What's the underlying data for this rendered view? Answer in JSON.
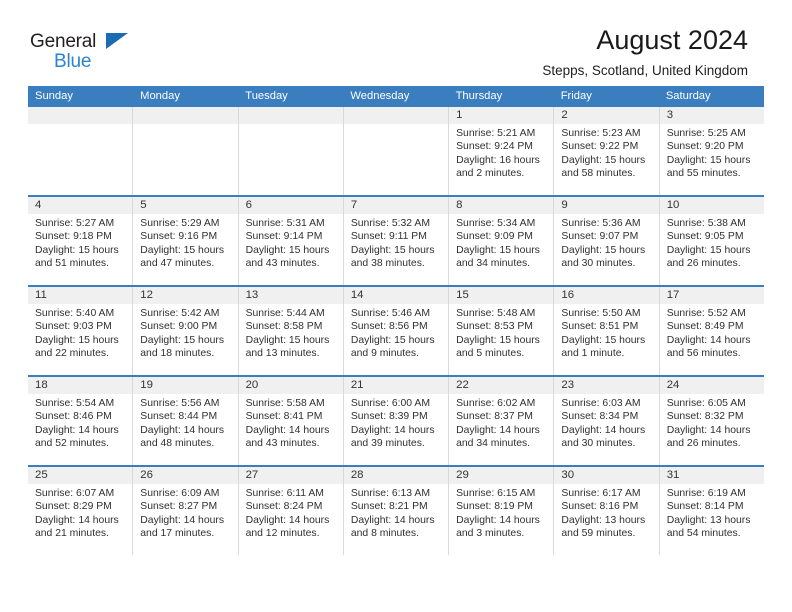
{
  "brand": {
    "line1": "General",
    "line2": "Blue",
    "accent": "#2b84cf",
    "triangle": "#1c6cb5"
  },
  "header": {
    "title": "August 2024",
    "subtitle": "Stepps, Scotland, United Kingdom"
  },
  "theme": {
    "header_bar": "#3a7ebf",
    "daynum_band": "#f0f0f0",
    "cell_border": "#d9d9d9",
    "text": "#303030"
  },
  "labels": {
    "sunrise": "Sunrise:",
    "sunset": "Sunset:",
    "daylight": "Daylight:"
  },
  "weekdays": [
    "Sunday",
    "Monday",
    "Tuesday",
    "Wednesday",
    "Thursday",
    "Friday",
    "Saturday"
  ],
  "weeks": [
    [
      {
        "day": "",
        "empty": true
      },
      {
        "day": "",
        "empty": true
      },
      {
        "day": "",
        "empty": true
      },
      {
        "day": "",
        "empty": true
      },
      {
        "day": "1",
        "sunrise": "Sunrise: 5:21 AM",
        "sunset": "Sunset: 9:24 PM",
        "daylight1": "Daylight: 16 hours",
        "daylight2": "and 2 minutes."
      },
      {
        "day": "2",
        "sunrise": "Sunrise: 5:23 AM",
        "sunset": "Sunset: 9:22 PM",
        "daylight1": "Daylight: 15 hours",
        "daylight2": "and 58 minutes."
      },
      {
        "day": "3",
        "sunrise": "Sunrise: 5:25 AM",
        "sunset": "Sunset: 9:20 PM",
        "daylight1": "Daylight: 15 hours",
        "daylight2": "and 55 minutes."
      }
    ],
    [
      {
        "day": "4",
        "sunrise": "Sunrise: 5:27 AM",
        "sunset": "Sunset: 9:18 PM",
        "daylight1": "Daylight: 15 hours",
        "daylight2": "and 51 minutes."
      },
      {
        "day": "5",
        "sunrise": "Sunrise: 5:29 AM",
        "sunset": "Sunset: 9:16 PM",
        "daylight1": "Daylight: 15 hours",
        "daylight2": "and 47 minutes."
      },
      {
        "day": "6",
        "sunrise": "Sunrise: 5:31 AM",
        "sunset": "Sunset: 9:14 PM",
        "daylight1": "Daylight: 15 hours",
        "daylight2": "and 43 minutes."
      },
      {
        "day": "7",
        "sunrise": "Sunrise: 5:32 AM",
        "sunset": "Sunset: 9:11 PM",
        "daylight1": "Daylight: 15 hours",
        "daylight2": "and 38 minutes."
      },
      {
        "day": "8",
        "sunrise": "Sunrise: 5:34 AM",
        "sunset": "Sunset: 9:09 PM",
        "daylight1": "Daylight: 15 hours",
        "daylight2": "and 34 minutes."
      },
      {
        "day": "9",
        "sunrise": "Sunrise: 5:36 AM",
        "sunset": "Sunset: 9:07 PM",
        "daylight1": "Daylight: 15 hours",
        "daylight2": "and 30 minutes."
      },
      {
        "day": "10",
        "sunrise": "Sunrise: 5:38 AM",
        "sunset": "Sunset: 9:05 PM",
        "daylight1": "Daylight: 15 hours",
        "daylight2": "and 26 minutes."
      }
    ],
    [
      {
        "day": "11",
        "sunrise": "Sunrise: 5:40 AM",
        "sunset": "Sunset: 9:03 PM",
        "daylight1": "Daylight: 15 hours",
        "daylight2": "and 22 minutes."
      },
      {
        "day": "12",
        "sunrise": "Sunrise: 5:42 AM",
        "sunset": "Sunset: 9:00 PM",
        "daylight1": "Daylight: 15 hours",
        "daylight2": "and 18 minutes."
      },
      {
        "day": "13",
        "sunrise": "Sunrise: 5:44 AM",
        "sunset": "Sunset: 8:58 PM",
        "daylight1": "Daylight: 15 hours",
        "daylight2": "and 13 minutes."
      },
      {
        "day": "14",
        "sunrise": "Sunrise: 5:46 AM",
        "sunset": "Sunset: 8:56 PM",
        "daylight1": "Daylight: 15 hours",
        "daylight2": "and 9 minutes."
      },
      {
        "day": "15",
        "sunrise": "Sunrise: 5:48 AM",
        "sunset": "Sunset: 8:53 PM",
        "daylight1": "Daylight: 15 hours",
        "daylight2": "and 5 minutes."
      },
      {
        "day": "16",
        "sunrise": "Sunrise: 5:50 AM",
        "sunset": "Sunset: 8:51 PM",
        "daylight1": "Daylight: 15 hours",
        "daylight2": "and 1 minute."
      },
      {
        "day": "17",
        "sunrise": "Sunrise: 5:52 AM",
        "sunset": "Sunset: 8:49 PM",
        "daylight1": "Daylight: 14 hours",
        "daylight2": "and 56 minutes."
      }
    ],
    [
      {
        "day": "18",
        "sunrise": "Sunrise: 5:54 AM",
        "sunset": "Sunset: 8:46 PM",
        "daylight1": "Daylight: 14 hours",
        "daylight2": "and 52 minutes."
      },
      {
        "day": "19",
        "sunrise": "Sunrise: 5:56 AM",
        "sunset": "Sunset: 8:44 PM",
        "daylight1": "Daylight: 14 hours",
        "daylight2": "and 48 minutes."
      },
      {
        "day": "20",
        "sunrise": "Sunrise: 5:58 AM",
        "sunset": "Sunset: 8:41 PM",
        "daylight1": "Daylight: 14 hours",
        "daylight2": "and 43 minutes."
      },
      {
        "day": "21",
        "sunrise": "Sunrise: 6:00 AM",
        "sunset": "Sunset: 8:39 PM",
        "daylight1": "Daylight: 14 hours",
        "daylight2": "and 39 minutes."
      },
      {
        "day": "22",
        "sunrise": "Sunrise: 6:02 AM",
        "sunset": "Sunset: 8:37 PM",
        "daylight1": "Daylight: 14 hours",
        "daylight2": "and 34 minutes."
      },
      {
        "day": "23",
        "sunrise": "Sunrise: 6:03 AM",
        "sunset": "Sunset: 8:34 PM",
        "daylight1": "Daylight: 14 hours",
        "daylight2": "and 30 minutes."
      },
      {
        "day": "24",
        "sunrise": "Sunrise: 6:05 AM",
        "sunset": "Sunset: 8:32 PM",
        "daylight1": "Daylight: 14 hours",
        "daylight2": "and 26 minutes."
      }
    ],
    [
      {
        "day": "25",
        "sunrise": "Sunrise: 6:07 AM",
        "sunset": "Sunset: 8:29 PM",
        "daylight1": "Daylight: 14 hours",
        "daylight2": "and 21 minutes."
      },
      {
        "day": "26",
        "sunrise": "Sunrise: 6:09 AM",
        "sunset": "Sunset: 8:27 PM",
        "daylight1": "Daylight: 14 hours",
        "daylight2": "and 17 minutes."
      },
      {
        "day": "27",
        "sunrise": "Sunrise: 6:11 AM",
        "sunset": "Sunset: 8:24 PM",
        "daylight1": "Daylight: 14 hours",
        "daylight2": "and 12 minutes."
      },
      {
        "day": "28",
        "sunrise": "Sunrise: 6:13 AM",
        "sunset": "Sunset: 8:21 PM",
        "daylight1": "Daylight: 14 hours",
        "daylight2": "and 8 minutes."
      },
      {
        "day": "29",
        "sunrise": "Sunrise: 6:15 AM",
        "sunset": "Sunset: 8:19 PM",
        "daylight1": "Daylight: 14 hours",
        "daylight2": "and 3 minutes."
      },
      {
        "day": "30",
        "sunrise": "Sunrise: 6:17 AM",
        "sunset": "Sunset: 8:16 PM",
        "daylight1": "Daylight: 13 hours",
        "daylight2": "and 59 minutes."
      },
      {
        "day": "31",
        "sunrise": "Sunrise: 6:19 AM",
        "sunset": "Sunset: 8:14 PM",
        "daylight1": "Daylight: 13 hours",
        "daylight2": "and 54 minutes."
      }
    ]
  ]
}
